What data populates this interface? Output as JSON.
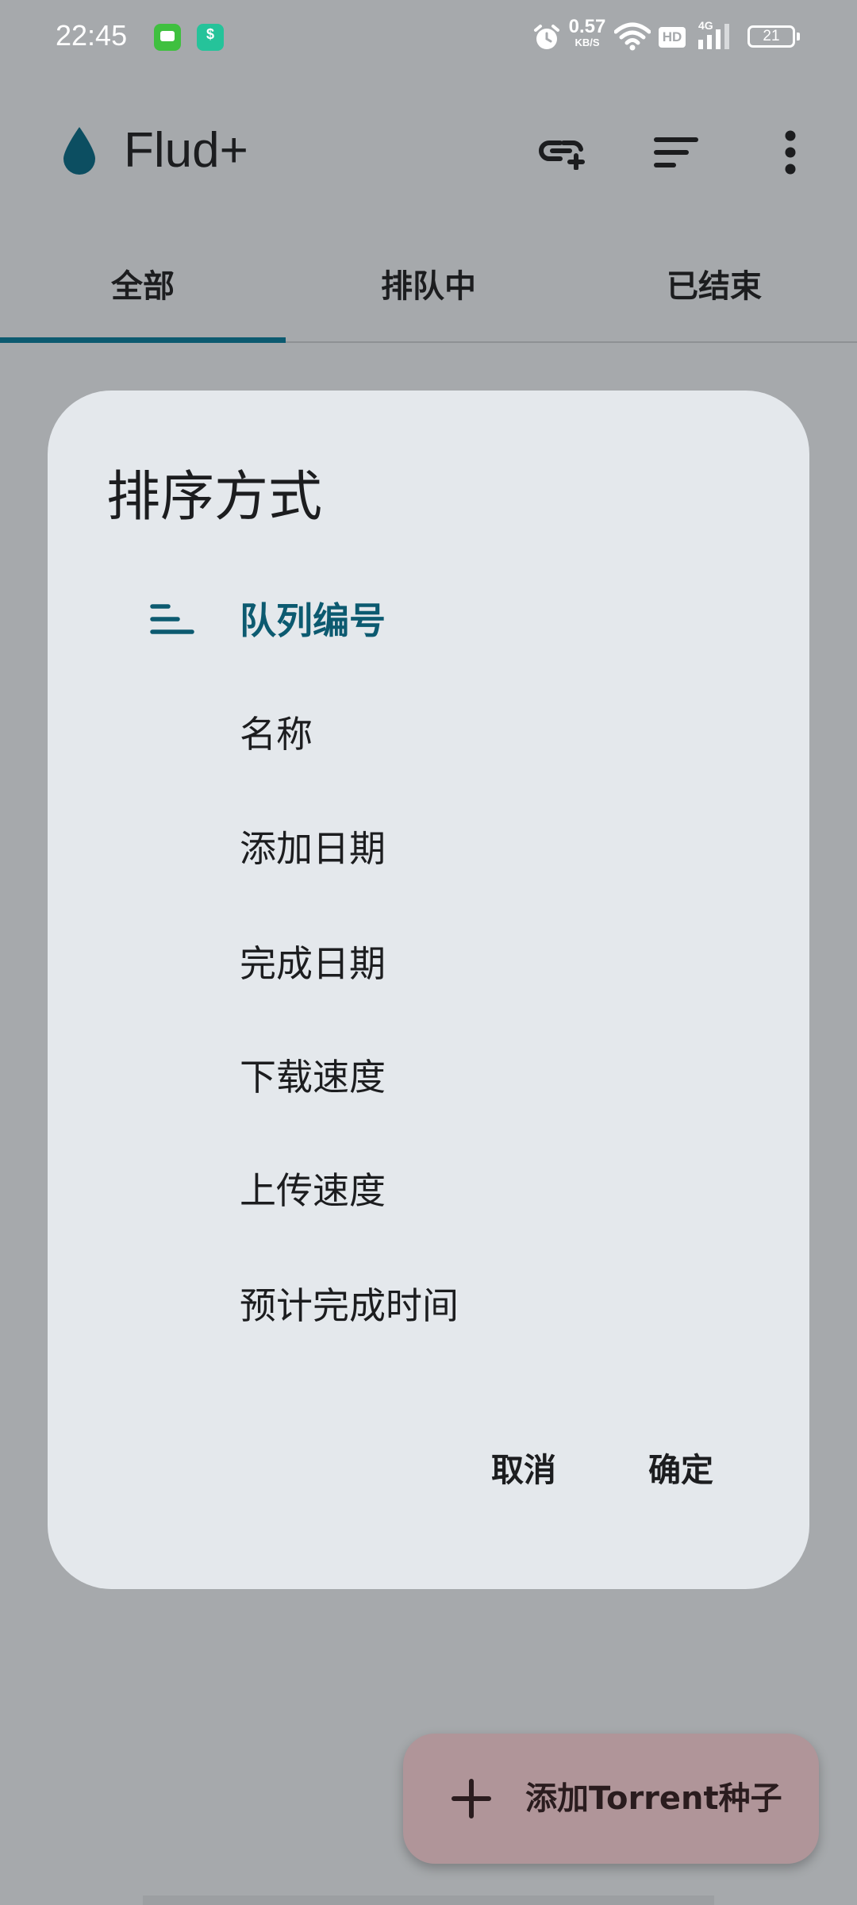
{
  "status_bar": {
    "time": "22:45",
    "net_speed_value": "0.57",
    "net_speed_unit": "KB/S",
    "hd_label": "HD",
    "signal_label": "4G",
    "battery": "21"
  },
  "app_bar": {
    "title": "Flud+",
    "icons": [
      "water-drop-logo",
      "add-link-icon",
      "sort-icon",
      "more-vert-icon"
    ]
  },
  "tabs": [
    {
      "label": "全部",
      "selected": true
    },
    {
      "label": "排队中",
      "selected": false
    },
    {
      "label": "已结束",
      "selected": false
    }
  ],
  "dialog": {
    "title": "排序方式",
    "options": [
      {
        "label": "队列编号",
        "selected": true
      },
      {
        "label": "名称",
        "selected": false
      },
      {
        "label": "添加日期",
        "selected": false
      },
      {
        "label": "完成日期",
        "selected": false
      },
      {
        "label": "下载速度",
        "selected": false
      },
      {
        "label": "上传速度",
        "selected": false
      },
      {
        "label": "预计完成时间",
        "selected": false
      }
    ],
    "cancel_label": "取消",
    "confirm_label": "确定"
  },
  "fab": {
    "label": "添加Torrent种子",
    "icon": "plus-icon"
  },
  "colors": {
    "accent": "#0c5a70",
    "scrim_background": "#a6a9ac",
    "dialog_surface": "#e4e8ec",
    "fab_container": "#b09599"
  }
}
